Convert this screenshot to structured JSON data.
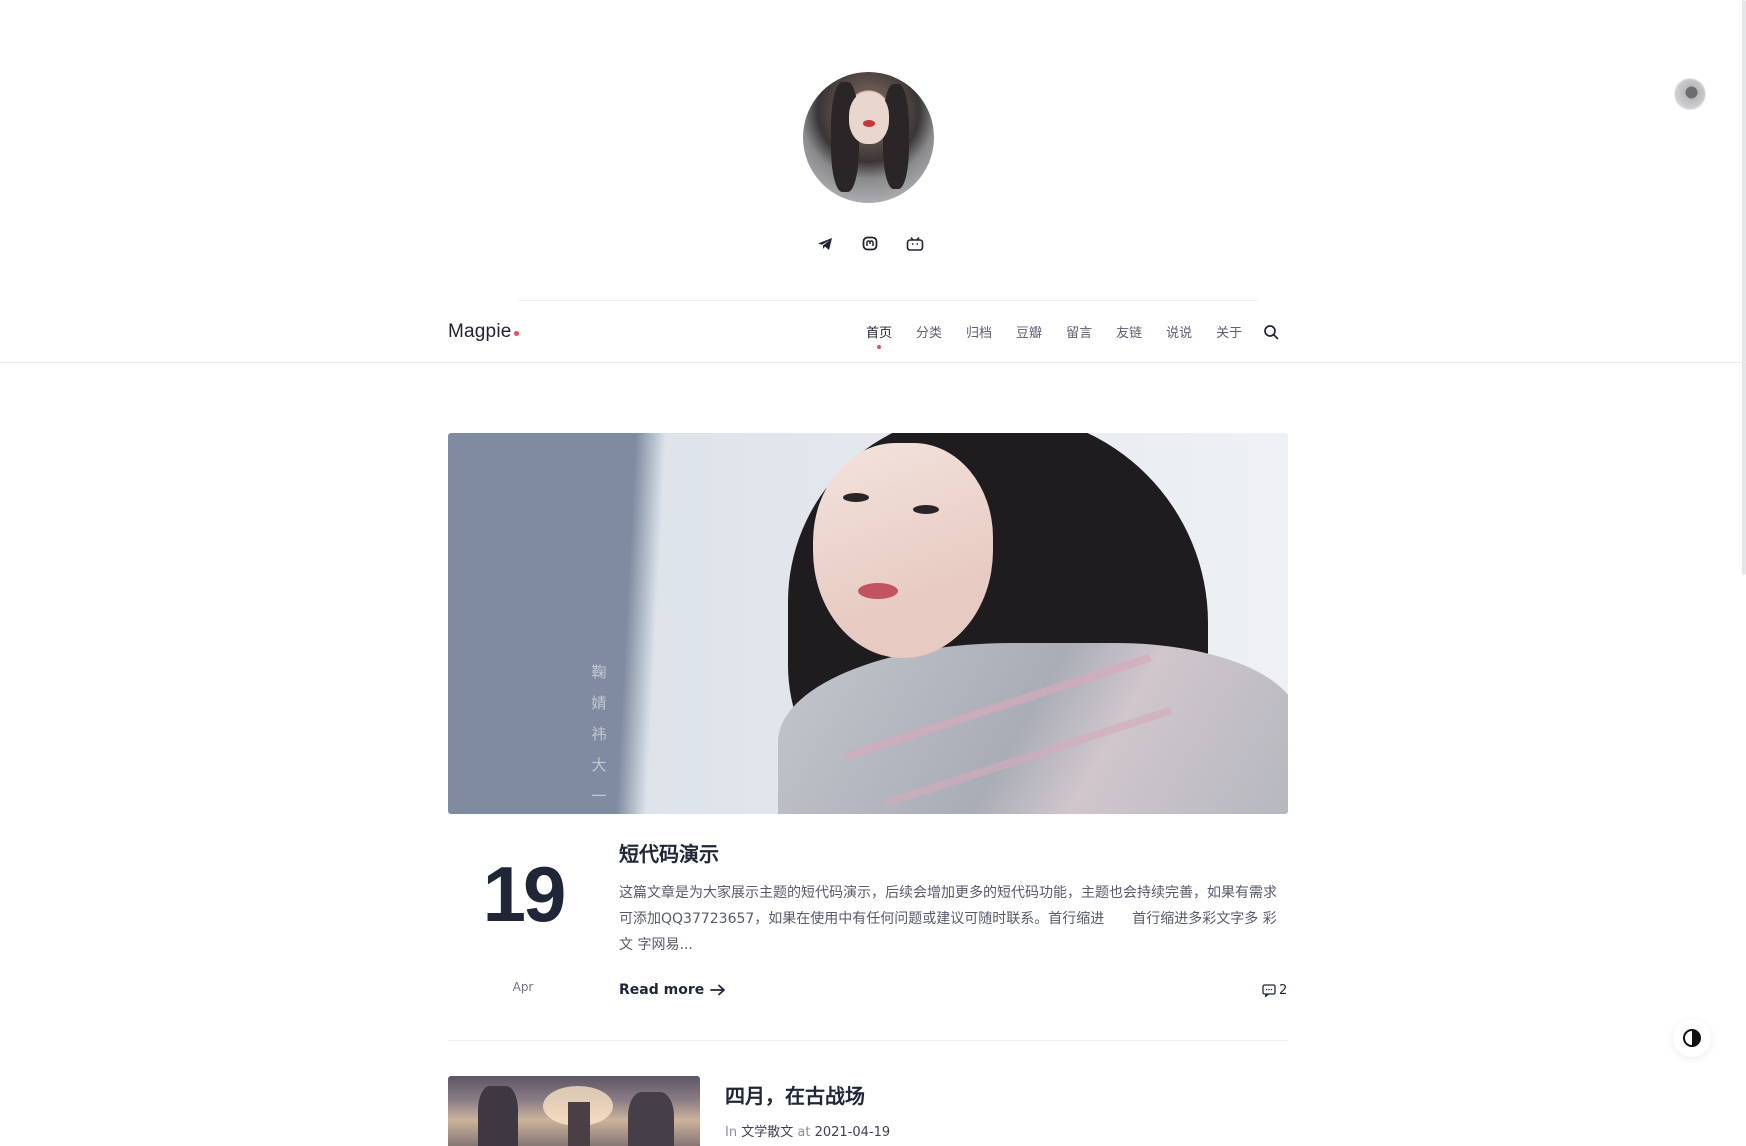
{
  "site": {
    "brand": "Magpie",
    "accent_color": "#e84a5f"
  },
  "profile": {
    "avatar_icon": "profile-avatar",
    "socials": [
      {
        "name": "telegram-icon"
      },
      {
        "name": "mastodon-icon"
      },
      {
        "name": "bilibili-icon"
      }
    ]
  },
  "nav": {
    "items": [
      "首页",
      "分类",
      "归档",
      "豆瓣",
      "留言",
      "友链",
      "说说",
      "关于"
    ],
    "active_index": 0,
    "search_icon": "search-icon"
  },
  "hero": {
    "vertical_text": [
      "鞠",
      "婧",
      "祎",
      "大",
      "一"
    ]
  },
  "posts": [
    {
      "day": "19",
      "month": "Apr",
      "title": "短代码演示",
      "excerpt": "这篇文章是为大家展示主题的短代码演示，后续会增加更多的短代码功能，主题也会持续完善，如果有需求可添加QQ37723657，如果在使用中有任何问题或建议可随时联系。首行缩进　　首行缩进多彩文字多 彩 文 字网易...",
      "read_more": "Read more",
      "comments": "2"
    },
    {
      "title": "四月，在古战场",
      "meta_in": "In",
      "category": "文学散文",
      "meta_at": "at",
      "date": "2021-04-19"
    }
  ],
  "theme_toggle_icon": "contrast-icon"
}
